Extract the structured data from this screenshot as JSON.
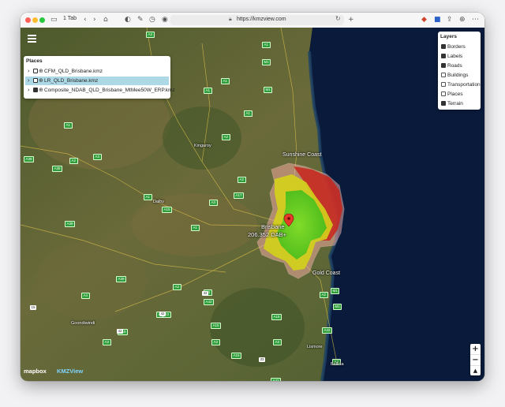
{
  "browser": {
    "tab_count": "1 Tab",
    "url": "https://kmzview.com"
  },
  "places": {
    "title": "Places",
    "items": [
      {
        "label": "CFM_QLD_Brisbane.kmz",
        "checked": false,
        "selected": false
      },
      {
        "label": "LR_QLD_Brisbane.kmz",
        "checked": false,
        "selected": true
      },
      {
        "label": "Composite_NDAB_QLD_Brisbane_MtMee50W_ERP.kmz",
        "checked": true,
        "selected": false
      }
    ]
  },
  "layers": {
    "title": "Layers",
    "items": [
      {
        "label": "Borders",
        "checked": true
      },
      {
        "label": "Labels",
        "checked": true
      },
      {
        "label": "Roads",
        "checked": true
      },
      {
        "label": "Buildings",
        "checked": false
      },
      {
        "label": "Transportation",
        "checked": false
      },
      {
        "label": "Places",
        "checked": false
      },
      {
        "label": "Terrain",
        "checked": true
      }
    ]
  },
  "map": {
    "place_labels": [
      "Sunshine Coast",
      "Brisbane",
      "Gold Coast",
      "Kingaroy",
      "Dalby",
      "Goondiwindi",
      "Lismore",
      "Ballina"
    ],
    "marker_label": "206.352 DAB+",
    "road_shields": [
      "A3",
      "A1",
      "A1",
      "A1",
      "A1",
      "A2",
      "A2",
      "A3",
      "A17",
      "A15",
      "A39",
      "A39",
      "A39",
      "M1",
      "M1",
      "A3",
      "A2",
      "A1",
      "A39",
      "A2",
      "A4",
      "A42",
      "A7",
      "A15",
      "A15",
      "A15",
      "A2",
      "M1",
      "M1",
      "A15",
      "A42",
      "A1",
      "A3",
      "A3",
      "A3",
      "A3",
      "A3",
      "A42",
      "A2",
      "A1"
    ],
    "road_route_numbers": [
      "15",
      "42",
      "42",
      "42",
      "33"
    ]
  },
  "controls": {
    "zoom_in": "+",
    "zoom_out": "−",
    "compass": "▲"
  },
  "attribution": {
    "mapbox": "mapbox",
    "kmzview": "KMZView"
  },
  "colors": {
    "coverage_strong": "#55c81a",
    "coverage_medium": "#d4d21a",
    "coverage_weak": "#c8241c",
    "ocean": "#0a1a3a",
    "selected_row": "#add8e6"
  }
}
